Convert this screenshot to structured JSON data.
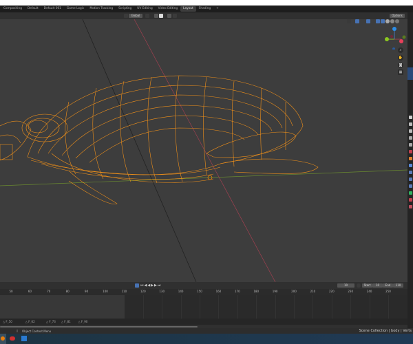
{
  "workspace_tabs": [
    "Compositing",
    "Default",
    "Default 001",
    "Game Logic",
    "Motion Tracking",
    "Scripting",
    "UV Editing",
    "Video Editing",
    "Layout",
    "Shading"
  ],
  "active_tab": "Layout",
  "add_tab_label": "+",
  "viewport_header": {
    "transform_orientation": "Global",
    "options_label": "Options"
  },
  "gizmo": {
    "z": "Z",
    "y": "Y",
    "x": "X"
  },
  "colors": {
    "wireframe": "#f0901a",
    "x_axis": "#a04050",
    "y_axis": "#6a8a30",
    "accent": "#4772b3"
  },
  "timeline": {
    "current_frame": "10",
    "start_label": "Start",
    "start": "10",
    "end_label": "End",
    "end": "110",
    "ticks": [
      "50",
      "60",
      "70",
      "80",
      "90",
      "100",
      "110",
      "120",
      "130",
      "140",
      "150",
      "160",
      "170",
      "180",
      "190",
      "200",
      "210",
      "220",
      "230",
      "240",
      "250"
    ],
    "markers": [
      "F_50",
      "F_62",
      "F_73",
      "F_81",
      "F_90"
    ]
  },
  "status": {
    "left": "Object Context Menu",
    "right": "Scene Collection | body | Verts"
  }
}
